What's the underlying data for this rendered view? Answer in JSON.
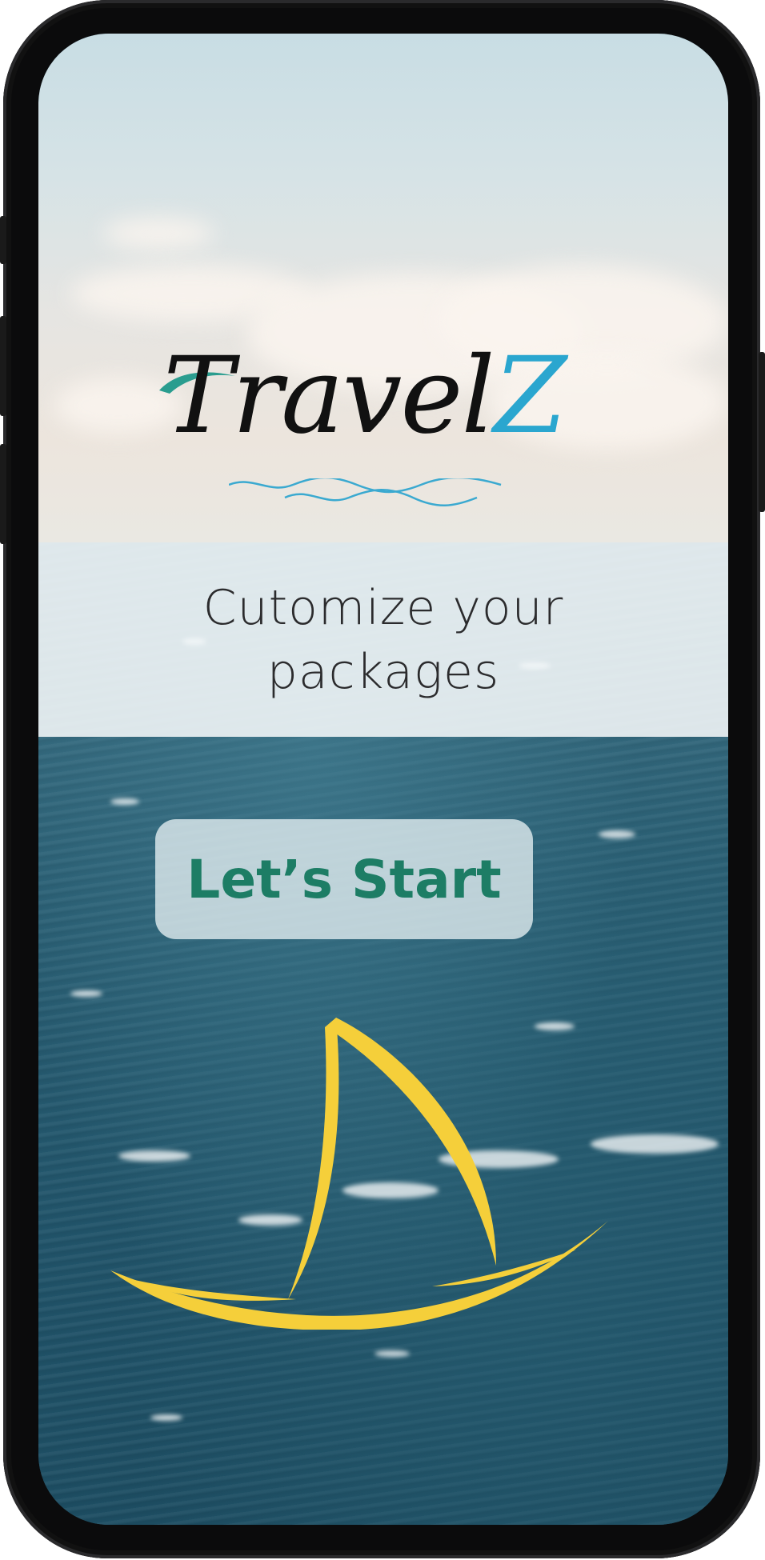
{
  "app": {
    "logo_text_main": "Travel",
    "logo_text_accent": "Z",
    "tagline": "Cutomize your packages",
    "start_button_label": "Let’s Start"
  },
  "colors": {
    "logo_accent": "#2aa6cf",
    "logo_palm": "#2a9d8f",
    "button_text": "#1d7d65",
    "boat": "#f5cf3a"
  },
  "icons": {
    "logo_waves": "wave-icon",
    "boat": "boat-icon"
  }
}
